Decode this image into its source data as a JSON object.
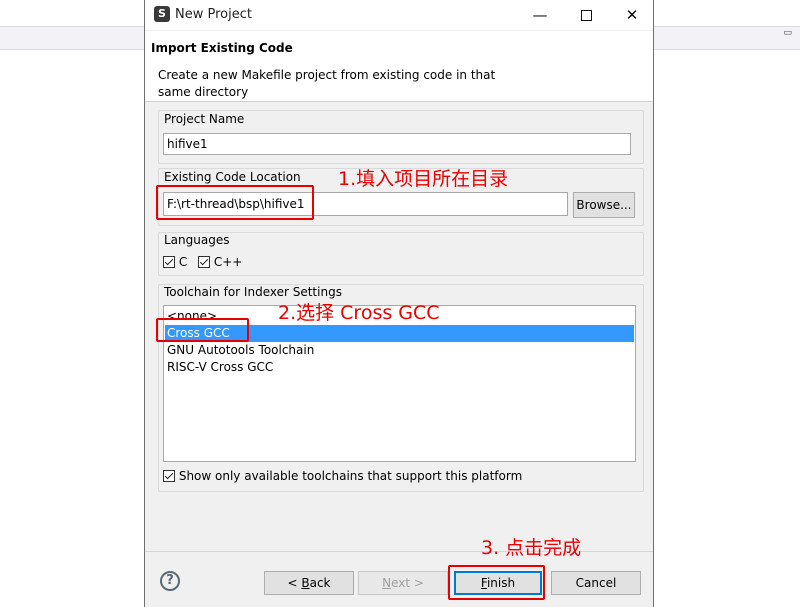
{
  "window": {
    "title": "New Project",
    "app_icon": "S"
  },
  "banner": {
    "title": "Import Existing Code",
    "description": "Create a new Makefile project from existing code in that same directory"
  },
  "project_name": {
    "label": "Project Name",
    "value": "hifive1"
  },
  "code_location": {
    "label": "Existing Code Location",
    "value": "F:\\rt-thread\\bsp\\hifive1",
    "browse_label": "Browse..."
  },
  "languages": {
    "label": "Languages",
    "c_label": "C",
    "cpp_label": "C++"
  },
  "toolchain": {
    "label": "Toolchain for Indexer Settings",
    "items": [
      "<none>",
      "Cross GCC",
      "GNU Autotools Toolchain",
      "RISC-V Cross GCC"
    ],
    "selected": "Cross GCC",
    "filter_label": "Show only available toolchains that support this platform"
  },
  "footer": {
    "help": "?",
    "back_prefix": "< ",
    "back_key": "B",
    "back_rest": "ack",
    "next_key": "N",
    "next_rest": "ext >",
    "finish_key": "F",
    "finish_rest": "inish",
    "cancel_label": "Cancel"
  },
  "annotations": {
    "step1": "1.填入项目所在目录",
    "step2": "2.选择 Cross GCC",
    "step3": "3. 点击完成",
    "color": "#e60000"
  },
  "colors": {
    "selection": "#3399ff",
    "default_button_border": "#0078d7"
  }
}
